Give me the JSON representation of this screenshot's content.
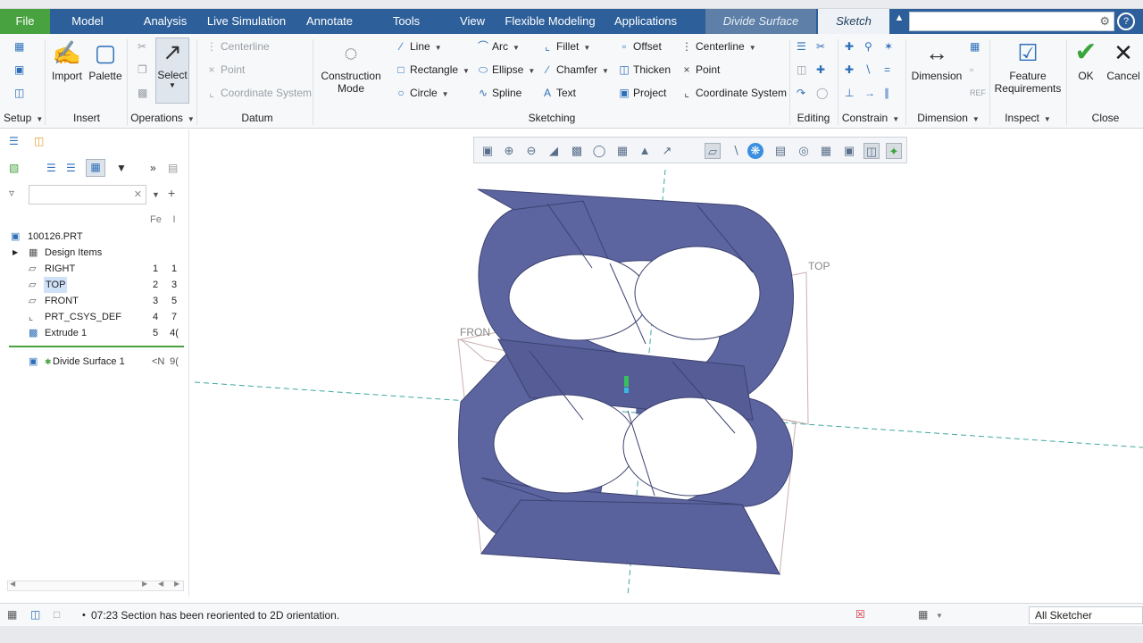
{
  "menu": {
    "file": "File",
    "tabs": [
      "Model",
      "Analysis",
      "Live Simulation",
      "Annotate",
      "Tools",
      "View",
      "Flexible Modeling",
      "Applications"
    ],
    "divide_surface": "Divide Surface",
    "sketch": "Sketch"
  },
  "ribbon": {
    "setup": {
      "label": "Setup"
    },
    "insert": {
      "import": "Import",
      "palette": "Palette",
      "label": "Insert"
    },
    "operations": {
      "select": "Select",
      "label": "Operations"
    },
    "datum": {
      "centerline": "Centerline",
      "point": "Point",
      "coordinate_system": "Coordinate System",
      "label": "Datum"
    },
    "construction": {
      "line1": "Construction",
      "line2": "Mode"
    },
    "sketching": {
      "line": "Line",
      "arc": "Arc",
      "fillet": "Fillet",
      "offset": "Offset",
      "centerline": "Centerline",
      "rectangle": "Rectangle",
      "ellipse": "Ellipse",
      "chamfer": "Chamfer",
      "thicken": "Thicken",
      "point": "Point",
      "circle": "Circle",
      "spline": "Spline",
      "text": "Text",
      "project": "Project",
      "coordinate_system": "Coordinate System",
      "label": "Sketching"
    },
    "editing": {
      "label": "Editing"
    },
    "constrain": {
      "label": "Constrain"
    },
    "dimension": {
      "button": "Dimension",
      "label": "Dimension"
    },
    "inspect": {
      "line1": "Feature",
      "line2": "Requirements",
      "label": "Inspect"
    },
    "close": {
      "ok": "OK",
      "cancel": "Cancel",
      "label": "Close"
    }
  },
  "tree": {
    "columns": [
      "Fe",
      "I"
    ],
    "items": [
      {
        "name": "100126.PRT",
        "c1": "",
        "c2": ""
      },
      {
        "name": "Design Items",
        "c1": "",
        "c2": ""
      },
      {
        "name": "RIGHT",
        "c1": "1",
        "c2": "1"
      },
      {
        "name": "TOP",
        "c1": "2",
        "c2": "3"
      },
      {
        "name": "FRONT",
        "c1": "3",
        "c2": "5"
      },
      {
        "name": "PRT_CSYS_DEF",
        "c1": "4",
        "c2": "7"
      },
      {
        "name": "Extrude 1",
        "c1": "5",
        "c2": "4("
      }
    ],
    "insert_item": {
      "name": "Divide Surface 1",
      "c1": "<N",
      "c2": "9("
    }
  },
  "graphics": {
    "top_label": "TOP",
    "front_label": "FRON",
    "model_color": "#5d65a1"
  },
  "status": {
    "message": "07:23 Section has been reoriented to 2D orientation.",
    "filter": "All Sketcher"
  },
  "colors": {
    "menubar": "#2d5f9a",
    "file_tab": "#48a23f",
    "accent": "#2c6fb8",
    "ok_green": "#3aa53a"
  }
}
